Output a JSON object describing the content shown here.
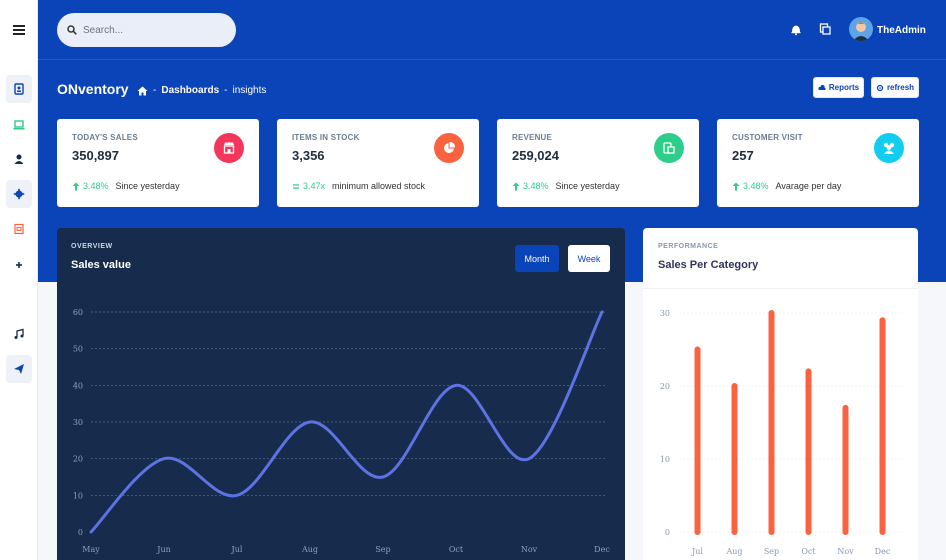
{
  "app": {
    "search_placeholder": "Search...",
    "username": "TheAdmin"
  },
  "header": {
    "title": "ONventory",
    "breadcrumb": [
      "Dashboards",
      "insights"
    ],
    "reports_label": "Reports",
    "refresh_label": "refresh"
  },
  "sidebar": {
    "items": [
      {
        "icon": "clipboard-user-icon",
        "color": "#0b43b8"
      },
      {
        "icon": "laptop-icon",
        "color": "#2dce89"
      },
      {
        "icon": "user-icon",
        "color": "#172b4d"
      },
      {
        "icon": "gear-icon",
        "color": "#0b43b8"
      },
      {
        "icon": "document-icon",
        "color": "#fb6340"
      },
      {
        "icon": "plus-icon",
        "color": "#172b4d"
      },
      {
        "icon": "music-icon",
        "color": "#172b4d"
      },
      {
        "icon": "paper-plane-icon",
        "color": "#0b43b8"
      }
    ]
  },
  "stats": [
    {
      "label": "TODAY'S SALES",
      "value": "350,897",
      "change": "3.48%",
      "note": "Since yesterday",
      "icon": "store-icon",
      "color": "#f5365c"
    },
    {
      "label": "ITEMS IN STOCK",
      "value": "3,356",
      "change": "3.47x",
      "note": "minimum allowed stock",
      "icon": "pie-icon",
      "color": "#fb6340"
    },
    {
      "label": "REVENUE",
      "value": "259,024",
      "change": "3.48%",
      "note": "Since yesterday",
      "icon": "money-icon",
      "color": "#2dce89"
    },
    {
      "label": "CUSTOMER VISIT",
      "value": "257",
      "change": "3.48%",
      "note": "Avarage per day",
      "icon": "users-icon",
      "color": "#11cdef"
    }
  ],
  "overview": {
    "kicker": "OVERVIEW",
    "title": "Sales value",
    "month_label": "Month",
    "week_label": "Week"
  },
  "performance": {
    "kicker": "PERFORMANCE",
    "title": "Sales Per Category"
  },
  "chart_data": [
    {
      "type": "line",
      "title": "Sales value",
      "x": [
        "May",
        "Jun",
        "Jul",
        "Aug",
        "Sep",
        "Oct",
        "Nov",
        "Dec"
      ],
      "series": [
        {
          "values": [
            0,
            20,
            10,
            30,
            15,
            40,
            20,
            60
          ]
        }
      ],
      "ylim": [
        0,
        60
      ],
      "yticks": [
        0,
        10,
        20,
        30,
        40,
        50,
        60
      ],
      "grid": true,
      "color": "#5e72e4"
    },
    {
      "type": "bar",
      "title": "Sales Per Category",
      "categories": [
        "Jul",
        "Aug",
        "Sep",
        "Oct",
        "Nov",
        "Dec"
      ],
      "values": [
        25,
        20,
        30,
        22,
        17,
        29
      ],
      "ylim": [
        0,
        30
      ],
      "yticks": [
        0,
        10,
        20,
        30
      ],
      "grid": true,
      "color": "#fb6340"
    }
  ]
}
